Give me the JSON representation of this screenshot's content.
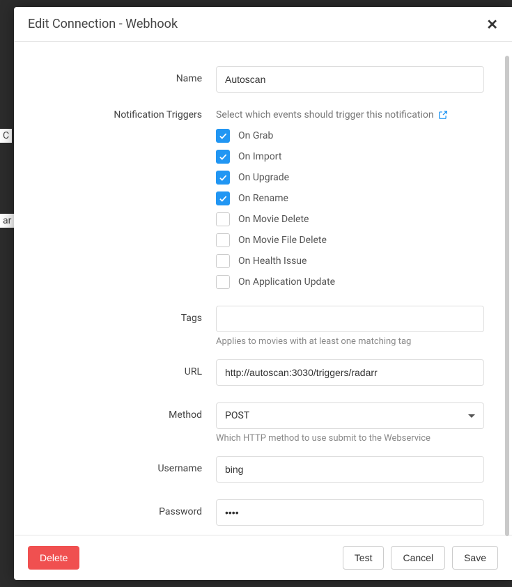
{
  "modal": {
    "title": "Edit Connection - Webhook",
    "close_glyph": "✕"
  },
  "form": {
    "name_label": "Name",
    "name_value": "Autoscan",
    "triggers_label": "Notification Triggers",
    "triggers_helper": "Select which events should trigger this notification",
    "triggers": [
      {
        "label": "On Grab",
        "checked": true
      },
      {
        "label": "On Import",
        "checked": true
      },
      {
        "label": "On Upgrade",
        "checked": true
      },
      {
        "label": "On Rename",
        "checked": true
      },
      {
        "label": "On Movie Delete",
        "checked": false
      },
      {
        "label": "On Movie File Delete",
        "checked": false
      },
      {
        "label": "On Health Issue",
        "checked": false
      },
      {
        "label": "On Application Update",
        "checked": false
      }
    ],
    "tags_label": "Tags",
    "tags_value": "",
    "tags_helper": "Applies to movies with at least one matching tag",
    "url_label": "URL",
    "url_value": "http://autoscan:3030/triggers/radarr",
    "method_label": "Method",
    "method_value": "POST",
    "method_helper": "Which HTTP method to use submit to the Webservice",
    "username_label": "Username",
    "username_value": "bing",
    "password_label": "Password",
    "password_value": "••••"
  },
  "footer": {
    "delete": "Delete",
    "test": "Test",
    "cancel": "Cancel",
    "save": "Save"
  },
  "bg": {
    "frag1": "C",
    "frag2": "ar"
  }
}
